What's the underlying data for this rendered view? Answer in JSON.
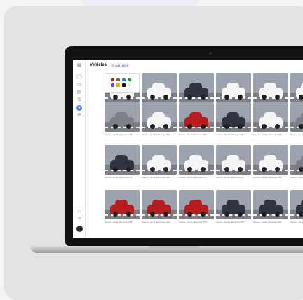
{
  "app": {
    "title": "Vehicles",
    "filter_chip": "Q, sort (4k)  ✕"
  },
  "icons": {
    "menu": "grid-menu-icon",
    "nav": [
      "chat-icon",
      "camera-icon",
      "calendar-icon",
      "filter-icon",
      "vehicle-icon",
      "settings-icon"
    ],
    "bottom": [
      "bell-icon",
      "help-icon"
    ]
  },
  "colors": {
    "accent": "#3b82f6",
    "car_red": "#b91c1c",
    "car_white": "#f5f5f5",
    "car_gray": "#7c7f86",
    "car_dark": "#2f3440"
  },
  "palette_colors": [
    "#b91c1c",
    "#8b5e34",
    "#2f6fe4",
    "#16a34a",
    "#7c3aed",
    "#eab308",
    "#111827",
    "#e5e7eb"
  ],
  "gallery": {
    "caption": "Source - South Elmwood LPR..."
  }
}
